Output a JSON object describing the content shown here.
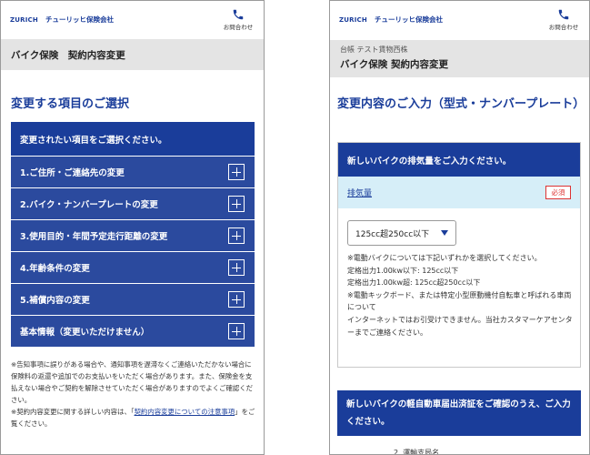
{
  "header": {
    "brand_logo": "ZURICH",
    "brand_name": "チューリッヒ保険会社",
    "contact_label": "お問合わせ"
  },
  "left": {
    "breadcrumb": "バイク保険　契約内容変更",
    "heading": "変更する項目のご選択",
    "menu_header": "変更されたい項目をご選択ください。",
    "menu_items": [
      "1.ご住所・ご連絡先の変更",
      "2.バイク・ナンバープレートの変更",
      "3.使用目的・年間予定走行距離の変更",
      "4.年齢条件の変更",
      "5.補償内容の変更",
      "基本情報（変更いただけません）"
    ],
    "notes": {
      "note1": "※告知事項に誤りがある場合や、通知事項を遅滞なくご連絡いただかない場合に保険料の返還や追加でのお支払いをいただく場合があります。また、保険金を支払えない場合やご契約を解除させていただく場合がありますのでよくご確認ください。",
      "note2_prefix": "※契約内容変更に関する詳しい内容は、「",
      "note2_link": "契約内容変更についての注意事項",
      "note2_suffix": "」をご覧ください。"
    }
  },
  "right": {
    "insured_name": "台帳 テスト賃物西株",
    "page_subtitle": "バイク保険 契約内容変更",
    "heading": "変更内容のご入力（型式・ナンバープレート）",
    "card_header": "新しいバイクの排気量をご入力ください。",
    "field_label": "排気量",
    "required_label": "必須",
    "select_value": "125cc超250cc以下",
    "field_notes": [
      "※電動バイクについては下記いずれかを選択してください。",
      "定格出力1.00kw以下: 125cc以下",
      "定格出力1.00kw超: 125cc超250cc以下",
      "※電動キックボード、または特定小型原動機付自転車と呼ばれる車両について",
      "インターネットではお引受けできません。当社カスタマーケアセンターまでご連絡ください。"
    ],
    "next_header": "新しいバイクの軽自動車届出済証をご確認のうえ、ご入力ください。",
    "partial_text": "2. 運輸支局名"
  },
  "colors": {
    "primary": "#1a3d9a",
    "menu_item": "#2b4a9e",
    "label_bg": "#d6eef8",
    "required": "#dd3333",
    "breadcrumb_bg": "#e4e4e4"
  },
  "icons": {
    "contact": "phone-icon",
    "expand": "plus-icon",
    "dropdown": "caret-down-icon"
  }
}
